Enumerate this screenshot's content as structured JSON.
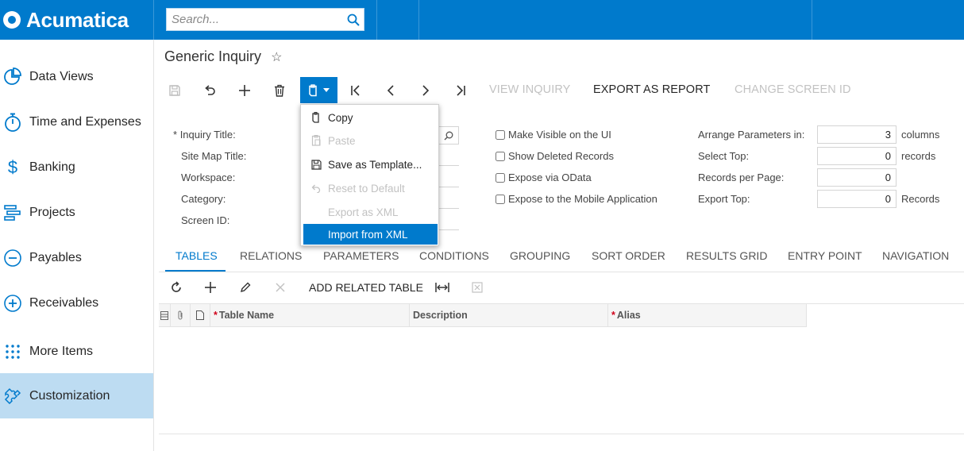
{
  "app": {
    "name": "Acumatica"
  },
  "search": {
    "placeholder": "Search..."
  },
  "sidebar": {
    "items": [
      {
        "label": "Data Views",
        "icon": "pie-chart-icon"
      },
      {
        "label": "Time and Expenses",
        "icon": "stopwatch-icon"
      },
      {
        "label": "Banking",
        "icon": "dollar-icon"
      },
      {
        "label": "Projects",
        "icon": "gantt-icon"
      },
      {
        "label": "Payables",
        "icon": "minus-circle-icon"
      },
      {
        "label": "Receivables",
        "icon": "plus-circle-icon"
      },
      {
        "label": "More Items",
        "icon": "grid-dots-icon"
      },
      {
        "label": "Customization",
        "icon": "puzzle-icon",
        "active": true
      }
    ]
  },
  "page": {
    "title": "Generic Inquiry"
  },
  "toolbar": {
    "view_inquiry": "VIEW INQUIRY",
    "export_as_report": "EXPORT AS REPORT",
    "change_screen_id": "CHANGE SCREEN ID"
  },
  "clipboard_menu": {
    "items": [
      {
        "label": "Copy",
        "icon": "copy-icon",
        "state": "enabled"
      },
      {
        "label": "Paste",
        "icon": "paste-icon",
        "state": "disabled"
      },
      {
        "label": "Save as Template...",
        "icon": "save-icon",
        "state": "enabled"
      },
      {
        "label": "Reset to Default",
        "icon": "undo-icon",
        "state": "disabled"
      },
      {
        "label": "Export as XML",
        "icon": "",
        "state": "disabled"
      },
      {
        "label": "Import from XML",
        "icon": "",
        "state": "selected"
      }
    ]
  },
  "form": {
    "required_marker": "*",
    "inquiry_title_label": "Inquiry Title:",
    "site_map_title_label": "Site Map Title:",
    "workspace_label": "Workspace:",
    "category_label": "Category:",
    "screen_id_label": "Screen ID:",
    "checkboxes": {
      "make_visible": "Make Visible on the UI",
      "show_deleted": "Show Deleted Records",
      "expose_odata": "Expose via OData",
      "expose_mobile": "Expose to the Mobile Application"
    },
    "arrange_label": "Arrange Parameters in:",
    "arrange_value": "3",
    "arrange_unit": "columns",
    "select_top_label": "Select Top:",
    "select_top_value": "0",
    "select_top_unit": "records",
    "records_per_page_label": "Records per Page:",
    "records_per_page_value": "0",
    "export_top_label": "Export Top:",
    "export_top_value": "0",
    "export_top_unit": "Records"
  },
  "tabs": [
    "TABLES",
    "RELATIONS",
    "PARAMETERS",
    "CONDITIONS",
    "GROUPING",
    "SORT ORDER",
    "RESULTS GRID",
    "ENTRY POINT",
    "NAVIGATION"
  ],
  "grid_toolbar": {
    "add_related_table": "ADD RELATED TABLE"
  },
  "grid": {
    "required_marker": "*",
    "columns": {
      "table_name": "Table Name",
      "description": "Description",
      "alias": "Alias"
    }
  },
  "colors": {
    "accent": "#007acc",
    "active_bg": "#bddcf2",
    "required": "#d0021b",
    "disabled": "#c2c2c2"
  }
}
